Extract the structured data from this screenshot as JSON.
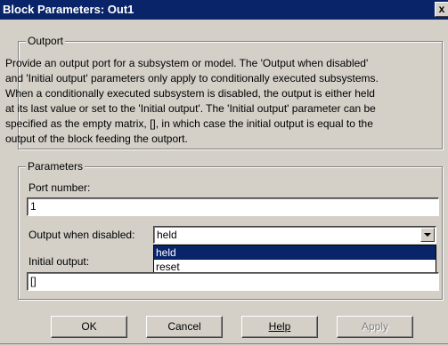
{
  "window": {
    "title": "Block Parameters: Out1",
    "close_label": "x"
  },
  "outport_group": {
    "legend": "Outport",
    "description_lines": [
      "Provide an output port for a subsystem or model.  The 'Output when disabled'",
      "and 'Initial output' parameters only apply to conditionally executed subsystems.",
      "When a conditionally executed subsystem is disabled, the output is either held",
      "at its last value or set to the 'Initial output'. The 'Initial output' parameter can be",
      "specified as the empty matrix, [], in which case the initial output is equal to the",
      "output of the block feeding the outport."
    ]
  },
  "parameters_group": {
    "legend": "Parameters",
    "port_number_label": "Port number:",
    "port_number_value": "1",
    "output_disabled_label": "Output when disabled:",
    "output_disabled_value": "held",
    "output_disabled_options": [
      "held",
      "reset"
    ],
    "initial_output_label": "Initial output:",
    "initial_output_value": "[]"
  },
  "buttons": {
    "ok": "OK",
    "cancel": "Cancel",
    "help": "Help",
    "apply": "Apply"
  }
}
